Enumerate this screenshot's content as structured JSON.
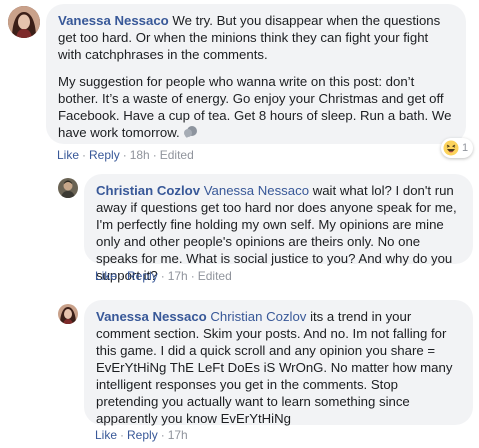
{
  "comments": [
    {
      "author": "Vanessa Nessaco",
      "text_parts": [
        "We try. But you disappear when the questions get too hard. Or when the minions think they can fight your fight with catchphrases in the comments.",
        "My suggestion for people who wanna write on this post: don’t bother. It’s a waste of energy. Go enjoy your Christmas and get off Facebook. Have a cup of tea. Get 8 hours of sleep. Run a bath. We have work tomorrow."
      ],
      "actions": {
        "like": "Like",
        "reply": "Reply",
        "time": "18h",
        "edited": "Edited"
      },
      "reaction_count": "1"
    },
    {
      "author": "Christian Cozlov",
      "mention": "Vanessa Nessaco",
      "text": "wait what lol? I don't run away if questions get too hard nor does anyone speak for me, I'm perfectly fine holding my own self. My opinions are mine only and other people's opinions are theirs only. No one speaks for me. What is social justice to you? And why do you support it?",
      "actions": {
        "like": "Like",
        "reply": "Reply",
        "time": "17h",
        "edited": "Edited"
      }
    },
    {
      "author": "Vanessa Nessaco",
      "mention": "Christian Cozlov",
      "text": "its a trend in your comment section. Skim your posts. And no. Im not falling for this game. I did a quick scroll and any opinion you share = EvErYtHiNg ThE LeFt DoEs iS WrOnG. No matter how many intelligent responses you get in the comments. Stop pretending you actually want to learn something since apparently you know EvErYtHiNg",
      "actions": {
        "like": "Like",
        "reply": "Reply",
        "time": "17h"
      }
    }
  ],
  "colors": {
    "link": "#385898",
    "bubble": "#f2f3f5",
    "meta": "#90949c"
  },
  "icons": [
    "speech-emoji-icon",
    "haha-reaction-icon"
  ]
}
